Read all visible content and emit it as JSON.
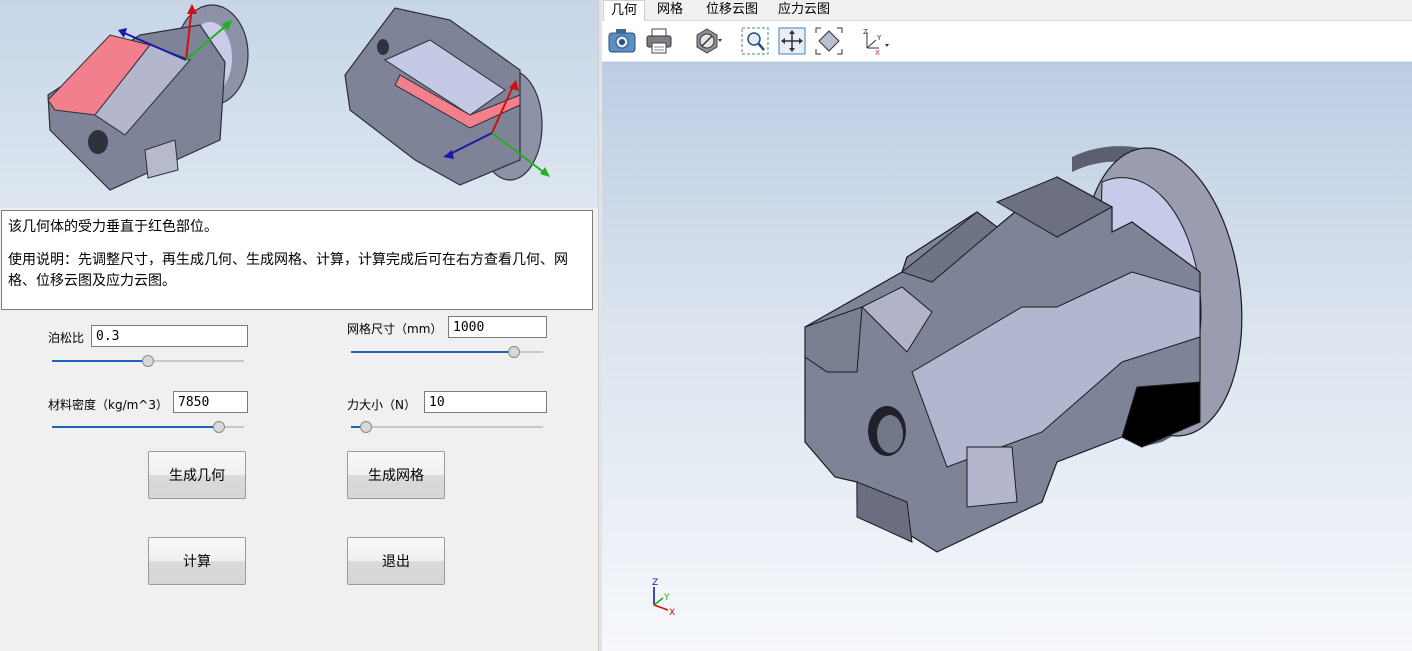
{
  "description": {
    "line1": "该几何体的受力垂直于红色部位。",
    "line2": "使用说明：先调整尺寸，再生成几何、生成网格、计算，计算完成后可在右方查看几何、网格、位移云图及应力云图。"
  },
  "params": {
    "poisson": {
      "label": "泊松比",
      "value": "0.3",
      "slider_fraction": 0.5
    },
    "mesh_size": {
      "label": "网格尺寸（mm）",
      "value": "1000",
      "slider_fraction": 0.85
    },
    "density": {
      "label": "材料密度（kg/m^3）",
      "value": "7850",
      "slider_fraction": 0.87
    },
    "force": {
      "label": "力大小（N）",
      "value": "10",
      "slider_fraction": 0.08
    }
  },
  "buttons": {
    "gen_geometry": "生成几何",
    "gen_mesh": "生成网格",
    "compute": "计算",
    "exit": "退出"
  },
  "tabs": [
    {
      "label": "几何",
      "active": true
    },
    {
      "label": "网格",
      "active": false
    },
    {
      "label": "位移云图",
      "active": false
    },
    {
      "label": "应力云图",
      "active": false
    }
  ],
  "toolbar": {
    "icons": [
      "camera-icon",
      "printer-icon",
      "visibility-icon",
      "zoom-window-icon",
      "pan-icon",
      "fit-view-icon",
      "axes-orientation-icon"
    ]
  },
  "triad": {
    "z": "Z",
    "y": "Y",
    "x": "X"
  },
  "colors": {
    "accent": "#1d64b8",
    "part_face": "#7c8094",
    "part_light": "#c6c9e6",
    "load_face": "#f27f8c"
  }
}
